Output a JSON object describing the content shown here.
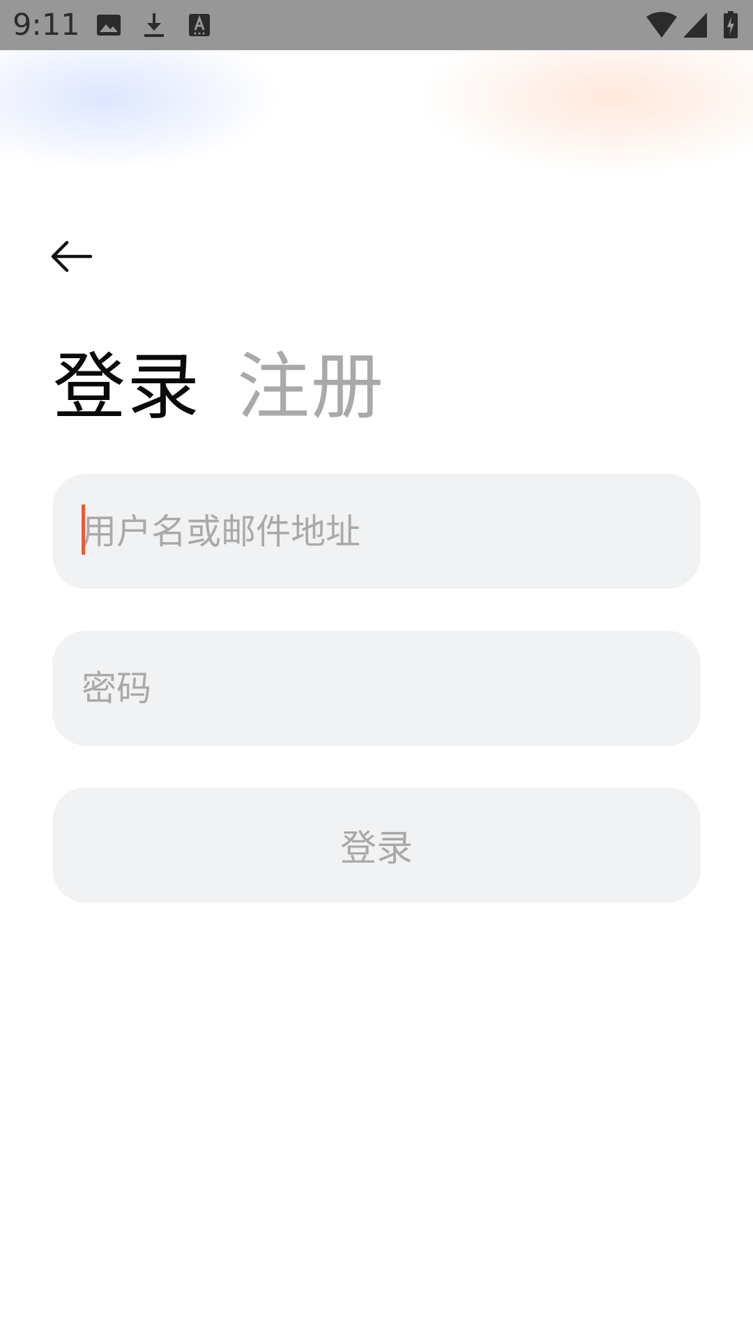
{
  "status_bar": {
    "time": "9:11",
    "icons": [
      "image-icon",
      "download-icon",
      "keyboard-a-icon",
      "wifi-icon",
      "signal-icon",
      "battery-charging-icon"
    ]
  },
  "nav": {
    "back_icon": "arrow-left-icon"
  },
  "tabs": {
    "login": "登录",
    "register": "注册"
  },
  "form": {
    "username_placeholder": "用户名或邮件地址",
    "username_value": "",
    "password_placeholder": "密码",
    "password_value": "",
    "submit_label": "登录"
  },
  "colors": {
    "status_bar_bg": "#979797",
    "field_bg": "#f1f2f4",
    "active_tab": "#0a0a0a",
    "inactive_text": "#a9a9a9",
    "caret": "#f0582f"
  }
}
